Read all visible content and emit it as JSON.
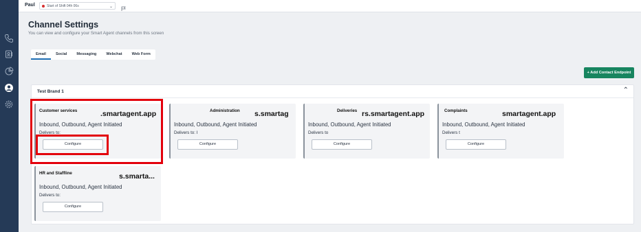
{
  "topbar": {
    "user_name": "Paul",
    "shift_status": "Start of Shift 04h 06s",
    "status_color": "#d62e2e"
  },
  "sidebar": {
    "items": [
      {
        "icon": "phone-icon"
      },
      {
        "icon": "contacts-icon"
      },
      {
        "icon": "reports-icon"
      },
      {
        "icon": "user-icon",
        "active": true
      },
      {
        "icon": "gear-icon"
      }
    ]
  },
  "header": {
    "title": "Channel Settings",
    "subtitle": "You can view and configure your Smart Agent channels from this screen"
  },
  "tabs": [
    {
      "label": "Email",
      "active": true
    },
    {
      "label": "Social"
    },
    {
      "label": "Messaging"
    },
    {
      "label": "Webchat"
    },
    {
      "label": "Web Form"
    }
  ],
  "add_endpoint_label": "+ Add Contact Endpoint",
  "panel": {
    "title": "Test Brand 1",
    "cards": [
      {
        "name": "Customer services",
        "domain": ".smartagent.app",
        "direction": "Inbound, Outbound, Agent Initiated",
        "delivers": "Delivers to:",
        "button": "Configure"
      },
      {
        "name": "Administration",
        "domain": "s.smartag",
        "direction": "Inbound, Outbound, Agent Initiated",
        "delivers": "Delivers to: I",
        "button": "Configure"
      },
      {
        "name": "Deliveries",
        "domain": "rs.smartagent.app",
        "direction": "Inbound, Outbound, Agent Initiated",
        "delivers": "Delivers to",
        "button": "Configure"
      },
      {
        "name": "Complaints",
        "domain": "smartagent.app",
        "direction": "Inbound, Outbound, Agent Initiated",
        "delivers": "Delivers t",
        "button": "Configure"
      },
      {
        "name": "HR and Staffline",
        "domain": "s.smarta...",
        "direction": "Inbound, Outbound, Agent Initiated",
        "delivers": "Delivers to:",
        "button": "Configure"
      }
    ]
  },
  "colors": {
    "sidebar": "#253a57",
    "accent": "#17855f",
    "highlight": "#e3000b"
  }
}
